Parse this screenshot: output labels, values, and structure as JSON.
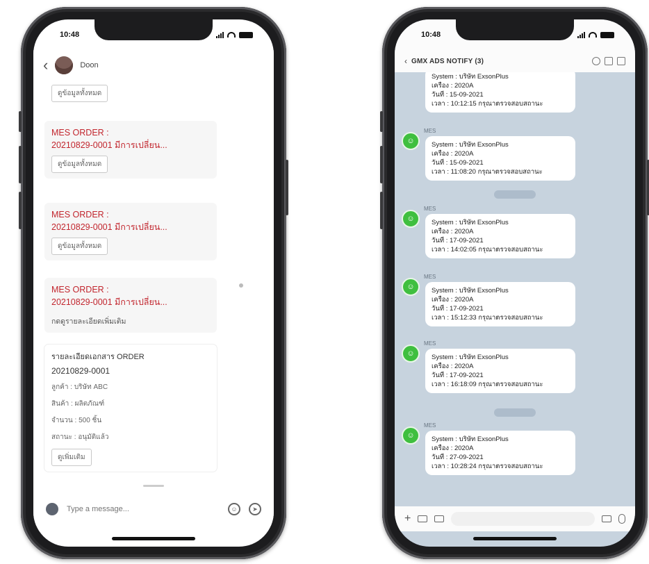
{
  "left_phone": {
    "status_time": "10:48",
    "header": {
      "contact_name": "Doon",
      "contact_sub": ""
    },
    "messages": [
      {
        "type": "button",
        "button": "ดูข้อมูลทั้งหมด"
      },
      {
        "type": "order",
        "title": "MES ORDER :",
        "detail": "20210829-0001 มีการเปลี่ยน...",
        "button": "ดูข้อมูลทั้งหมด"
      },
      {
        "type": "order",
        "title": "MES ORDER :",
        "detail": "20210829-0001 มีการเปลี่ยน...",
        "button": "ดูข้อมูลทั้งหมด"
      },
      {
        "type": "order",
        "title": "MES ORDER :",
        "detail": "20210829-0001 มีการเปลี่ยน...",
        "text": "กดดูรายละเอียดเพิ่มเติม"
      }
    ],
    "card": {
      "title": "รายละเอียดเอกสาร ORDER",
      "number": "20210829-0001",
      "lines": [
        "ลูกค้า : บริษัท ABC",
        "สินค้า : ผลิตภัณฑ์",
        "จำนวน : 500 ชิ้น",
        "สถานะ : อนุมัติแล้ว"
      ],
      "button": "ดูเพิ่มเติม"
    },
    "composer": {
      "placeholder": "Type a message..."
    }
  },
  "right_phone": {
    "status_time": "10:48",
    "header": {
      "title": "GMX ADS NOTIFY (3)"
    },
    "sender": "MES",
    "messages": [
      {
        "l1": "System : บริษัท ExsonPlus",
        "l2": "เครื่อง : 2020A",
        "l3": "วันที่ : 15-09-2021",
        "l4": "เวลา : 10:12:15 กรุณาตรวจสอบสถานะ",
        "time": ""
      },
      {
        "l1": "System : บริษัท ExsonPlus",
        "l2": "เครื่อง : 2020A",
        "l3": "วันที่ : 15-09-2021",
        "l4": "เวลา : 11:08:20 กรุณาตรวจสอบสถานะ",
        "time": ""
      },
      {
        "l1": "System : บริษัท ExsonPlus",
        "l2": "เครื่อง : 2020A",
        "l3": "วันที่ : 17-09-2021",
        "l4": "เวลา : 14:02:05 กรุณาตรวจสอบสถานะ",
        "time": ""
      },
      {
        "l1": "System : บริษัท ExsonPlus",
        "l2": "เครื่อง : 2020A",
        "l3": "วันที่ : 17-09-2021",
        "l4": "เวลา : 15:12:33 กรุณาตรวจสอบสถานะ",
        "time": ""
      },
      {
        "l1": "System : บริษัท ExsonPlus",
        "l2": "เครื่อง : 2020A",
        "l3": "วันที่ : 17-09-2021",
        "l4": "เวลา : 16:18:09 กรุณาตรวจสอบสถานะ",
        "time": ""
      },
      {
        "l1": "System : บริษัท ExsonPlus",
        "l2": "เครื่อง : 2020A",
        "l3": "วันที่ : 27-09-2021",
        "l4": "เวลา : 10:28:24 กรุณาตรวจสอบสถานะ",
        "time": ""
      }
    ],
    "colors": {
      "chat_bg": "#c7d3de",
      "avatar": "#3fbf3f",
      "order_red": "#c2262e"
    }
  }
}
